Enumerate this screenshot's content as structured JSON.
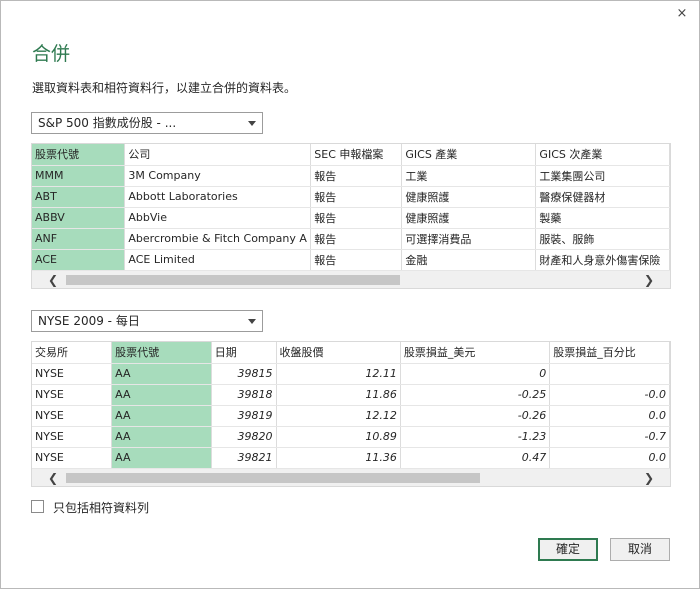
{
  "dialog": {
    "close_glyph": "×",
    "title": "合併",
    "subtitle": "選取資料表和相符資料行，以建立合併的資料表。"
  },
  "table1": {
    "dropdown_value": "S&P 500 指數成份股 - ...",
    "columns": [
      "股票代號",
      "公司",
      "SEC 申報檔案",
      "GICS 產業",
      "GICS 次產業"
    ],
    "selected_column": 0,
    "rows": [
      [
        "MMM",
        "3M Company",
        "報告",
        "工業",
        "工業集團公司"
      ],
      [
        "ABT",
        "Abbott Laboratories",
        "報告",
        "健康照護",
        "醫療保健器材"
      ],
      [
        "ABBV",
        "AbbVie",
        "報告",
        "健康照護",
        "製藥"
      ],
      [
        "ANF",
        "Abercrombie & Fitch Company A",
        "報告",
        "可選擇消費品",
        "服裝、服飾"
      ],
      [
        "ACE",
        "ACE Limited",
        "報告",
        "金融",
        "財產和人身意外傷害保險"
      ]
    ],
    "scroll_left": "❮",
    "scroll_right": "❯"
  },
  "table2": {
    "dropdown_value": "NYSE 2009 - 每日",
    "columns": [
      "交易所",
      "股票代號",
      "日期",
      "收盤股價",
      "股票損益_美元",
      "股票損益_百分比"
    ],
    "selected_column": 1,
    "rows": [
      [
        "NYSE",
        "AA",
        "39815",
        "12.11",
        "0",
        ""
      ],
      [
        "NYSE",
        "AA",
        "39818",
        "11.86",
        "-0.25",
        "-0.0"
      ],
      [
        "NYSE",
        "AA",
        "39819",
        "12.12",
        "-0.26",
        "0.0"
      ],
      [
        "NYSE",
        "AA",
        "39820",
        "10.89",
        "-1.23",
        "-0.7"
      ],
      [
        "NYSE",
        "AA",
        "39821",
        "11.36",
        "0.47",
        "0.0"
      ]
    ],
    "scroll_left": "❮",
    "scroll_right": "❯"
  },
  "options": {
    "matching_rows_label": "只包括相符資料列"
  },
  "buttons": {
    "ok": "確定",
    "cancel": "取消"
  }
}
